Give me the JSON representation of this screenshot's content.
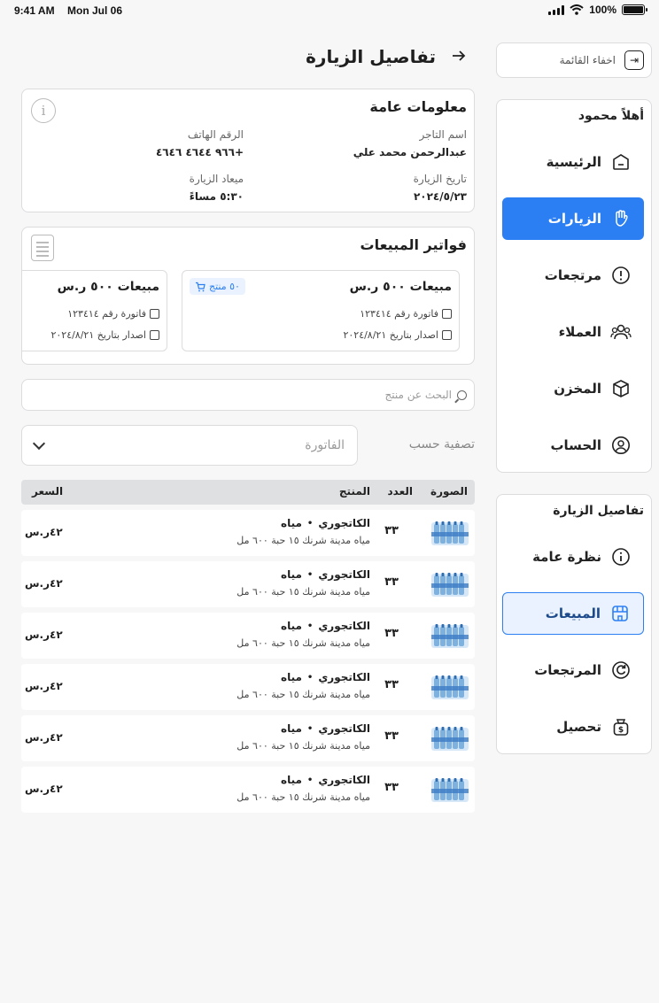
{
  "status": {
    "time": "9:41 AM",
    "date": "Mon Jul 06",
    "battery": "100%"
  },
  "sidebar": {
    "hide_menu_label": "اخفاء القائمة",
    "greeting": "أهلاً محمود",
    "nav": [
      {
        "label": "الرئيسية",
        "icon": "home-icon"
      },
      {
        "label": "الزيارات",
        "icon": "hand-wave-icon",
        "active": true
      },
      {
        "label": "مرتجعات",
        "icon": "alert-circle-icon"
      },
      {
        "label": "العملاء",
        "icon": "users-icon"
      },
      {
        "label": "المخزن",
        "icon": "box-icon"
      },
      {
        "label": "الحساب",
        "icon": "user-circle-icon"
      }
    ],
    "visit_details": {
      "title": "تفاصيل الزيارة",
      "items": [
        {
          "label": "نظرة عامة",
          "icon": "info-icon"
        },
        {
          "label": "المبيعات",
          "icon": "store-icon",
          "active": true
        },
        {
          "label": "المرتجعات",
          "icon": "refresh-icon"
        },
        {
          "label": "تحصيل",
          "icon": "money-bag-icon"
        }
      ]
    }
  },
  "page": {
    "title": "تفاصيل الزيارة"
  },
  "general_info": {
    "title": "معلومات عامة",
    "merchant_label": "اسم التاجر",
    "merchant_value": "عبدالرحمن محمد علي",
    "phone_label": "الرقم الهاتف",
    "phone_value": "+٩٦٦ ٤٦٤٤ ٤٦٤٦",
    "visit_date_label": "تاريخ الزيارة",
    "visit_date_value": "٢٠٢٤/٥/٢٣",
    "visit_time_label": "ميعاد الزيارة",
    "visit_time_value": "٥:٣٠ مساءً"
  },
  "invoices": {
    "title": "فواتير المبيعات",
    "items": [
      {
        "amount": "مبيعات ٥٠٠ ر.س",
        "badge": "٥٠ منتج",
        "invoice_no": "فاتورة رقم ١٢٣٤١٤",
        "issued": "اصدار بتاريخ ٢٠٢٤/٨/٢١"
      },
      {
        "amount": "مبيعات ٥٠٠ ر.س",
        "invoice_no": "فاتورة رقم ١٢٣٤١٤",
        "issued": "اصدار بتاريخ ٢٠٢٤/٨/٢١"
      }
    ]
  },
  "search": {
    "placeholder": "البحث عن منتج"
  },
  "filter": {
    "label": "تصفية حسب",
    "placeholder": "الفاتورة"
  },
  "table": {
    "headers": {
      "image": "الصورة",
      "qty": "العدد",
      "product": "المنتج",
      "price": "السعر"
    },
    "rows": [
      {
        "brand": "الكاتجوري",
        "sep": "•",
        "name": "مياه",
        "desc": "مياه مدينة شرنك ١٥ حبة ٦٠٠ مل",
        "qty": "٣٣",
        "price": "٤٢ر.س"
      },
      {
        "brand": "الكاتجوري",
        "sep": "•",
        "name": "مياه",
        "desc": "مياه مدينة شرنك ١٥ حبة ٦٠٠ مل",
        "qty": "٣٣",
        "price": "٤٢ر.س"
      },
      {
        "brand": "الكاتجوري",
        "sep": "•",
        "name": "مياه",
        "desc": "مياه مدينة شرنك ١٥ حبة ٦٠٠ مل",
        "qty": "٣٣",
        "price": "٤٢ر.س"
      },
      {
        "brand": "الكاتجوري",
        "sep": "•",
        "name": "مياه",
        "desc": "مياه مدينة شرنك ١٥ حبة ٦٠٠ مل",
        "qty": "٣٣",
        "price": "٤٢ر.س"
      },
      {
        "brand": "الكاتجوري",
        "sep": "•",
        "name": "مياه",
        "desc": "مياه مدينة شرنك ١٥ حبة ٦٠٠ مل",
        "qty": "٣٣",
        "price": "٤٢ر.س"
      },
      {
        "brand": "الكاتجوري",
        "sep": "•",
        "name": "مياه",
        "desc": "مياه مدينة شرنك ١٥ حبة ٦٠٠ مل",
        "qty": "٣٣",
        "price": "٤٢ر.س"
      }
    ]
  }
}
